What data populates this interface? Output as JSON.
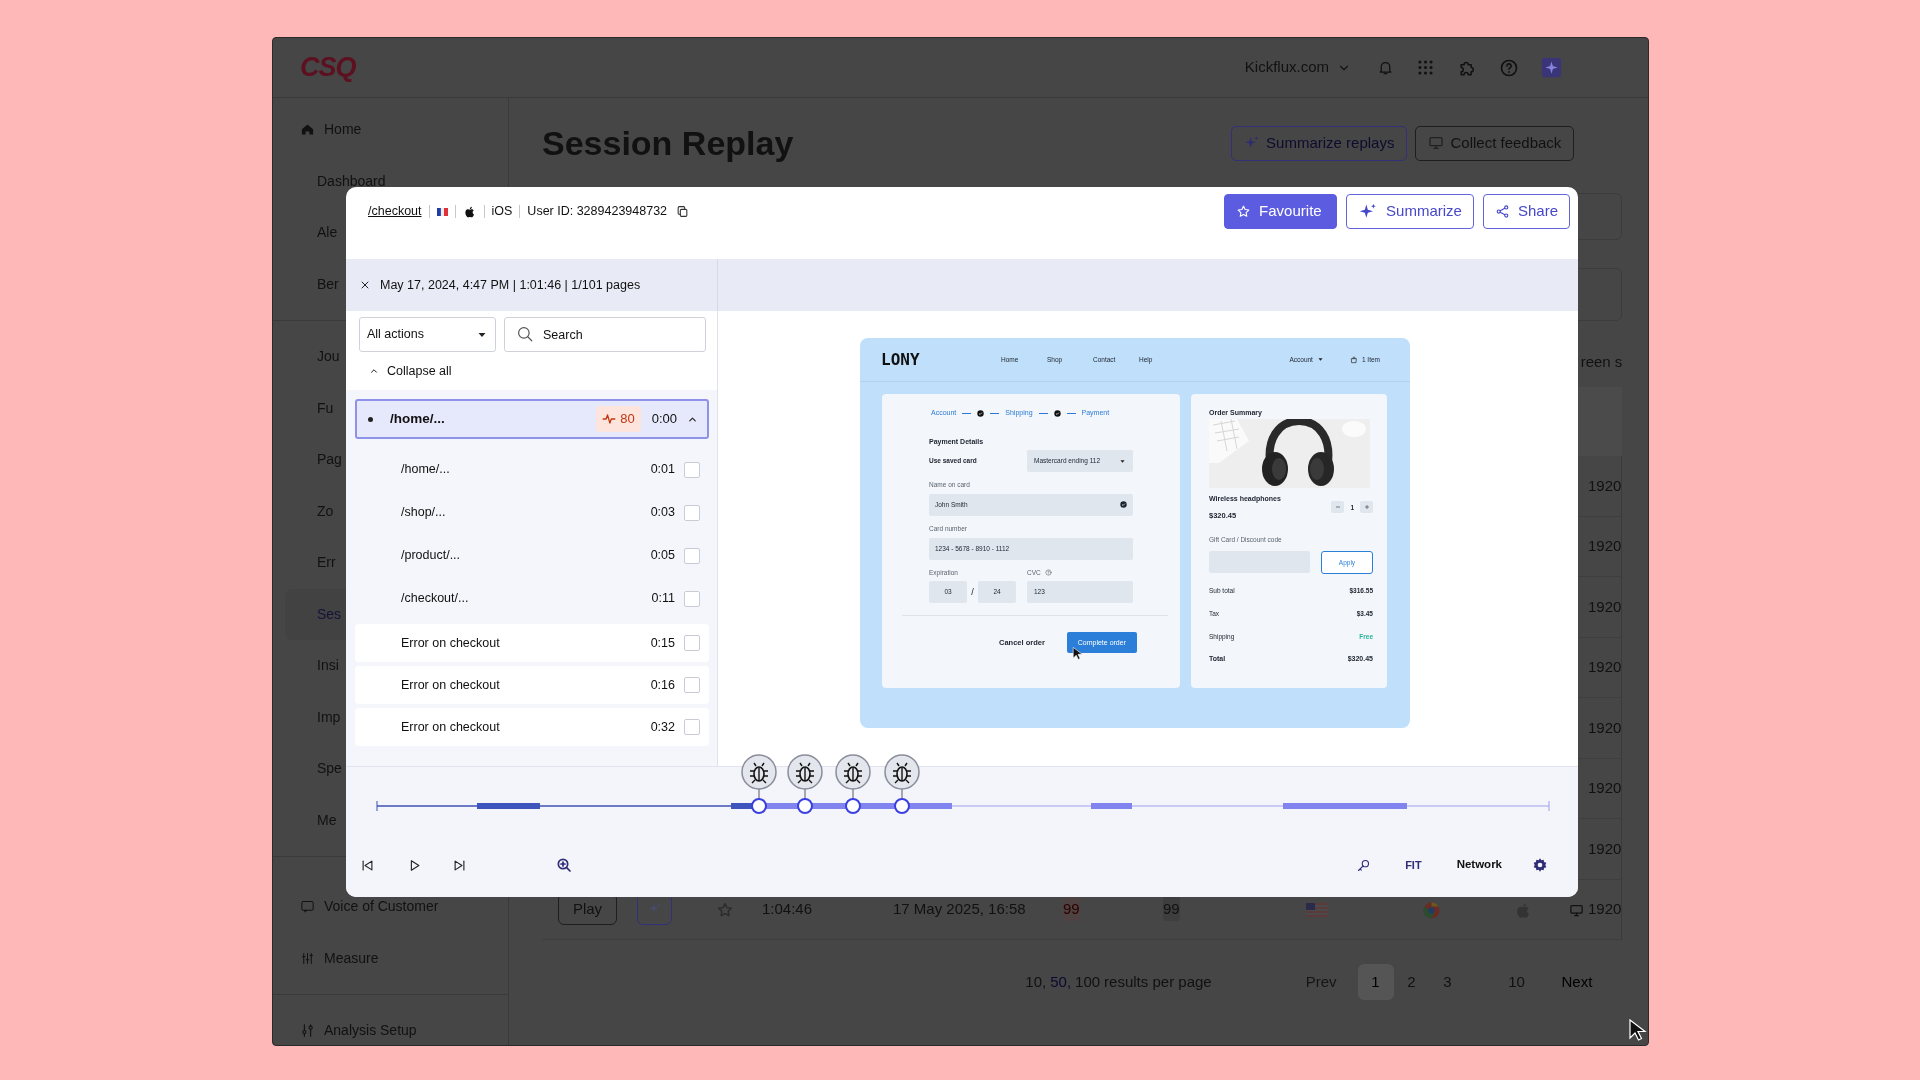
{
  "app": {
    "logo": "CSQ",
    "account": "Kickflux.com"
  },
  "sidebar": {
    "groups": [
      {
        "items": [
          {
            "label": "Home",
            "selected": false
          },
          {
            "label": "Dashboard",
            "selected": false
          },
          {
            "label": "Ale",
            "selected": false
          },
          {
            "label": "Ber",
            "selected": false
          }
        ]
      },
      {
        "items": [
          {
            "label": "Jou",
            "selected": false
          },
          {
            "label": "Fu",
            "selected": false
          },
          {
            "label": "Pag",
            "selected": false
          },
          {
            "label": "Zo",
            "selected": false
          },
          {
            "label": "Err",
            "selected": false
          },
          {
            "label": "Ses",
            "selected": true
          },
          {
            "label": "Insi",
            "selected": false
          },
          {
            "label": "Imp",
            "selected": false
          },
          {
            "label": "Spe",
            "selected": false
          },
          {
            "label": "Me",
            "selected": false
          }
        ]
      },
      {
        "items": [
          {
            "label": "Voice of Customer",
            "selected": false
          },
          {
            "label": "Measure",
            "selected": false
          }
        ]
      },
      {
        "items": [
          {
            "label": "Analysis Setup",
            "selected": false
          }
        ]
      }
    ]
  },
  "page": {
    "title": "Session Replay",
    "buttons": [
      {
        "label": "Summarize replays",
        "kind": "accent"
      },
      {
        "label": "Collect feedback",
        "kind": "plain"
      }
    ],
    "partial_text": "reen s",
    "rows": [
      {
        "kind": "covered",
        "resolution": "1920"
      },
      {
        "kind": "covered",
        "resolution": "1920"
      },
      {
        "kind": "covered",
        "resolution": "1920"
      },
      {
        "kind": "covered",
        "resolution": "1920"
      },
      {
        "kind": "covered",
        "resolution": "1920"
      },
      {
        "kind": "covered",
        "resolution": "1920"
      },
      {
        "kind": "covered",
        "resolution": "1920"
      },
      {
        "kind": "full",
        "play": "Play",
        "duration": "1:04:46",
        "date": "17 May 2025, 16:58",
        "score_1": "99",
        "score_2": "99",
        "resolution": "1920"
      }
    ],
    "pagination": {
      "per_page": [
        {
          "label": "10,",
          "selected": false
        },
        {
          "label": "50,",
          "selected": true
        },
        {
          "label": "100",
          "selected": false
        }
      ],
      "per_page_label": "results per page",
      "prev": {
        "label": "Prev",
        "disabled": true
      },
      "pages": [
        {
          "label": "1",
          "selected": true
        },
        {
          "label": "2",
          "selected": false
        },
        {
          "label": "3",
          "selected": false
        },
        {
          "label": "10",
          "selected": false
        }
      ],
      "next": {
        "label": "Next",
        "disabled": false
      }
    }
  },
  "modal": {
    "header": {
      "path": "/checkout",
      "os": "iOS",
      "user_id": "User ID: 3289423948732",
      "buttons": [
        {
          "label": "Favourite",
          "kind": "primary"
        },
        {
          "label": "Summarize",
          "kind": "outline"
        },
        {
          "label": "Share",
          "kind": "outline"
        }
      ]
    },
    "session_info": "May 17, 2024, 4:47 PM | 1:01:46 | 1/101 pages",
    "filter": {
      "value": "All actions"
    },
    "search": {
      "placeholder": "Search"
    },
    "collapse_label": "Collapse all",
    "page_group": {
      "label": "/home/...",
      "score": "80",
      "time": "0:00",
      "expanded": true,
      "selected": true,
      "children": [
        {
          "kind": "page",
          "label": "/home/...",
          "time": "0:01",
          "checked": false
        },
        {
          "kind": "page",
          "label": "/shop/...",
          "time": "0:03",
          "checked": false
        },
        {
          "kind": "page",
          "label": "/product/...",
          "time": "0:05",
          "checked": false
        },
        {
          "kind": "page",
          "label": "/checkout/...",
          "time": "0:11",
          "checked": false
        },
        {
          "kind": "event",
          "label": "Error on checkout",
          "time": "0:15",
          "checked": false
        },
        {
          "kind": "event",
          "label": "Error on checkout",
          "time": "0:16",
          "checked": false
        },
        {
          "kind": "event",
          "label": "Error on checkout",
          "time": "0:32",
          "checked": false
        }
      ]
    },
    "replay": {
      "logo": "LONY",
      "nav": [
        "Home",
        "Shop",
        "Contact",
        "Help"
      ],
      "account": "Account",
      "cart": "1 Item",
      "steps": [
        "Account",
        "Shipping",
        "Payment"
      ],
      "payment": {
        "title": "Payment Details",
        "saved_card_label": "Use saved card",
        "saved_card": "Mastercard ending 112",
        "name_label": "Name on card",
        "name": "John Smith",
        "card_label": "Card number",
        "card": "1234 - 5678 - 8910 - 1112",
        "exp_label": "Expiration",
        "exp_month": "03",
        "exp_sep": "/",
        "exp_year": "24",
        "cvc_label": "CVC",
        "cvc": "123",
        "cancel": "Cancel order",
        "submit": "Complete order"
      },
      "summary": {
        "title": "Order Summary",
        "product": "Wireless headphones",
        "price": "$320.45",
        "quantity": "1",
        "discount_label": "Gift Card / Discount code",
        "apply": "Apply",
        "lines": [
          {
            "kind": "normal",
            "label": "Sub total",
            "value": "$316.55"
          },
          {
            "kind": "normal",
            "label": "Tax",
            "value": "$3.45"
          },
          {
            "kind": "free",
            "label": "Shipping",
            "value": "Free"
          },
          {
            "kind": "total",
            "label": "Total",
            "value": "$320.45"
          }
        ]
      }
    },
    "player": {
      "fit": "FIT",
      "network": "Network"
    }
  }
}
